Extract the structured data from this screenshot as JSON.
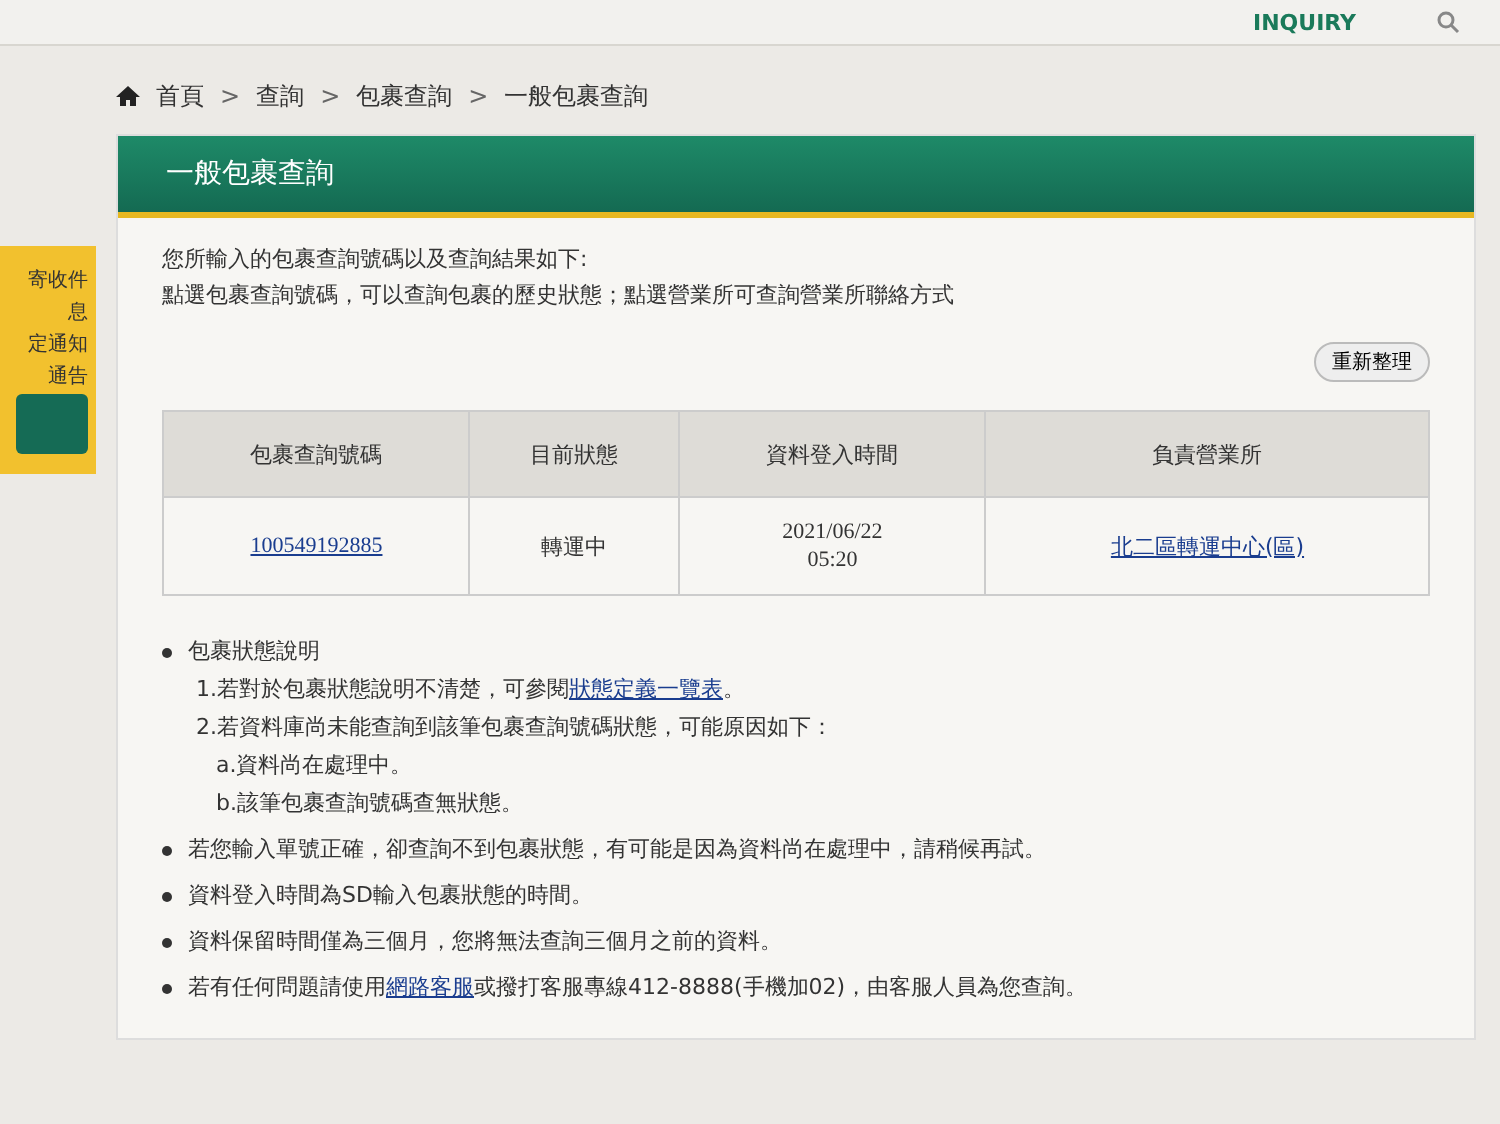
{
  "top_nav": {
    "items": [
      "INQUIRY"
    ]
  },
  "sidebar": {
    "notice_lines": [
      "寄收件",
      "息",
      "定通知",
      "通告"
    ]
  },
  "breadcrumb": [
    {
      "label": "首頁"
    },
    {
      "separator": ">",
      "label": "查詢"
    },
    {
      "separator": ">",
      "label": "包裹查詢"
    },
    {
      "separator": ">",
      "label": "一般包裹查詢"
    }
  ],
  "panel": {
    "title": "一般包裹查詢",
    "intro": [
      "您所輸入的包裹查詢號碼以及查詢結果如下:",
      "點選包裹查詢號碼，可以查詢包裹的歷史狀態；點選營業所可查詢營業所聯絡方式"
    ],
    "refresh_button": "重新整理",
    "table": {
      "columns": [
        "包裹查詢號碼",
        "目前狀態",
        "資料登入時間",
        "負責營業所"
      ],
      "rows": [
        {
          "tracking_number": "100549192885",
          "status": "轉運中",
          "date": "2021/06/22",
          "time": "05:20",
          "office": "北二區轉運中心(區)"
        }
      ]
    },
    "notes": [
      {
        "segments": [
          {
            "text": "包裹狀態說明",
            "link": false
          }
        ],
        "children": [
          {
            "kind": "item",
            "segments": [
              {
                "text": "1.若對於包裹狀態說明不清楚，可參閱",
                "link": false
              },
              {
                "text": "狀態定義一覽表",
                "link": true
              },
              {
                "text": "。",
                "link": false
              }
            ]
          },
          {
            "kind": "item",
            "segments": [
              {
                "text": "2.若資料庫尚未能查詢到該筆包裹查詢號碼狀態，可能原因如下：",
                "link": false
              }
            ]
          },
          {
            "kind": "subitem",
            "segments": [
              {
                "text": "a.資料尚在處理中。",
                "link": false
              }
            ]
          },
          {
            "kind": "subitem",
            "segments": [
              {
                "text": "b.該筆包裹查詢號碼查無狀態。",
                "link": false
              }
            ]
          }
        ]
      },
      {
        "segments": [
          {
            "text": "若您輸入單號正確，卻查詢不到包裹狀態，有可能是因為資料尚在處理中，請稍候再試。",
            "link": false
          }
        ]
      },
      {
        "segments": [
          {
            "text": "資料登入時間為SD輸入包裹狀態的時間。",
            "link": false
          }
        ]
      },
      {
        "segments": [
          {
            "text": "資料保留時間僅為三個月，您將無法查詢三個月之前的資料。",
            "link": false
          }
        ]
      },
      {
        "segments": [
          {
            "text": "若有任何問題請使用",
            "link": false
          },
          {
            "text": "網路客服",
            "link": true
          },
          {
            "text": "或撥打客服專線412-8888(手機加02)，由客服人員為您查詢。",
            "link": false
          }
        ]
      }
    ]
  }
}
